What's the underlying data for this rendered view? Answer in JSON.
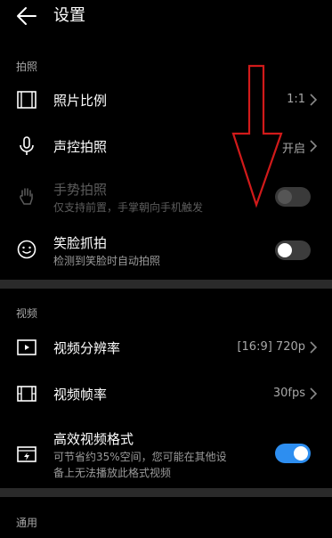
{
  "header": {
    "title": "设置"
  },
  "sections": {
    "photo": "拍照",
    "video": "视频",
    "general": "通用"
  },
  "items": {
    "aspect_ratio": {
      "title": "照片比例",
      "value": "1:1"
    },
    "voice_shot": {
      "title": "声控拍照",
      "value": "开启"
    },
    "gesture_shot": {
      "title": "手势拍照",
      "subtitle": "仅支持前置，手掌朝向手机触发",
      "enabled": false,
      "checked": false
    },
    "smile_capture": {
      "title": "笑脸抓拍",
      "subtitle": "检测到笑脸时自动拍照",
      "enabled": true,
      "checked": false
    },
    "video_resolution": {
      "title": "视频分辨率",
      "value": "[16:9] 720p"
    },
    "video_fps": {
      "title": "视频帧率",
      "value": "30fps"
    },
    "efficient_format": {
      "title": "高效视频格式",
      "subtitle_line1": "可节省约35%空间，您可能在其他设",
      "subtitle_line2": "备上无法播放此格式视频",
      "checked": true
    }
  },
  "colors": {
    "accent": "#2d8ef0",
    "annotation_red": "#d11a1a",
    "divider": "#2a2a2a"
  }
}
